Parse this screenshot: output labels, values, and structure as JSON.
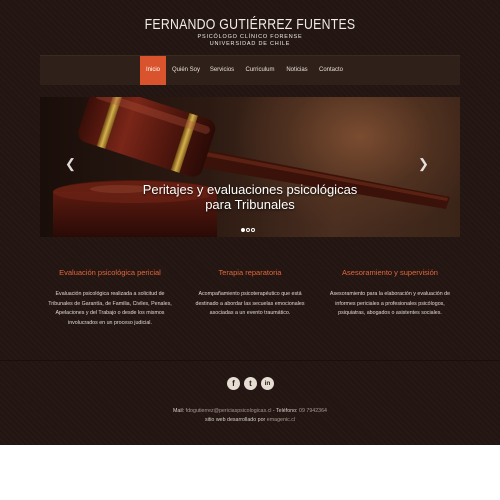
{
  "brand": {
    "name": "FERNANDO GUTIÉRREZ FUENTES",
    "subtitle1": "PSICÓLOGO CLÍNICO FORENSE",
    "subtitle2": "UNIVERSIDAD DE CHILE"
  },
  "nav": {
    "items": [
      "Inicio",
      "Quién Soy",
      "Servicios",
      "Curriculum",
      "Noticias",
      "Contacto"
    ],
    "active": "Inicio",
    "active_color": "#d9542c"
  },
  "hero": {
    "caption_line1": "Peritajes y evaluaciones psicológicas",
    "caption_line2": "para Tribunales",
    "prev_icon": "chevron-left-icon",
    "next_icon": "chevron-right-icon",
    "slide_count": 3,
    "active_slide": 1
  },
  "features": [
    {
      "title": "Evaluación psicológica pericial",
      "lines": [
        "Evaluación psicológica realizada a solicitud de",
        "Tribunales de Garantía, de Familia, Civiles, Penales,",
        "Apelaciones y del Trabajo o desde los mismos",
        "involucrados en un proceso judicial."
      ]
    },
    {
      "title": "Terapia reparatoria",
      "lines": [
        "Acompañamiento psicoterapéutico que está",
        "destinado a abordar las secuelas emocionales",
        "asociadas a un evento traumático."
      ]
    },
    {
      "title": "Asesoramiento y supervisión",
      "lines": [
        "Asesoramiento para la elaboración y evaluación de",
        "informes periciales a profesionales psicólogos,",
        "psiquiatras, abogados o asistentes sociales."
      ]
    }
  ],
  "accent_color": "#e2663a",
  "social": [
    {
      "icon": "facebook-icon",
      "glyph": "f"
    },
    {
      "icon": "twitter-icon",
      "glyph": "t"
    },
    {
      "icon": "linkedin-icon",
      "glyph": "in"
    }
  ],
  "footer": {
    "mail_label": "Mail:",
    "mail_value": "fdogutierrez@periciaspsicologicas.cl",
    "phone_label": "- Teléfono:",
    "phone_value": "09 7942364",
    "credit_text": "sitio web desarrollado por",
    "credit_link": "emagenic.cl"
  }
}
